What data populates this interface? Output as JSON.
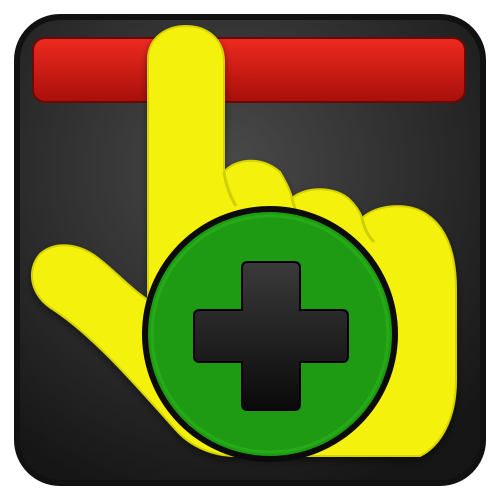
{
  "icon": {
    "name": "pointing-hand-add-icon",
    "parts": [
      "rounded-square-frame",
      "red-bar",
      "yellow-pointing-hand",
      "green-circle",
      "black-plus-sign"
    ]
  },
  "colors": {
    "background": "#ffffff",
    "frame_outer": "#111111",
    "frame_inner_light": "#4a4a4a",
    "frame_inner_dark": "#161616",
    "bar_red": "#e21b14",
    "bar_red_dark": "#a80f0a",
    "hand_yellow": "#f4f10c",
    "hand_outline": "#e8e400",
    "circle_green": "#1f9b13",
    "circle_outline": "#0b0b0b",
    "plus_black": "#0a0a0a",
    "plus_highlight": "#3a3a3a"
  }
}
